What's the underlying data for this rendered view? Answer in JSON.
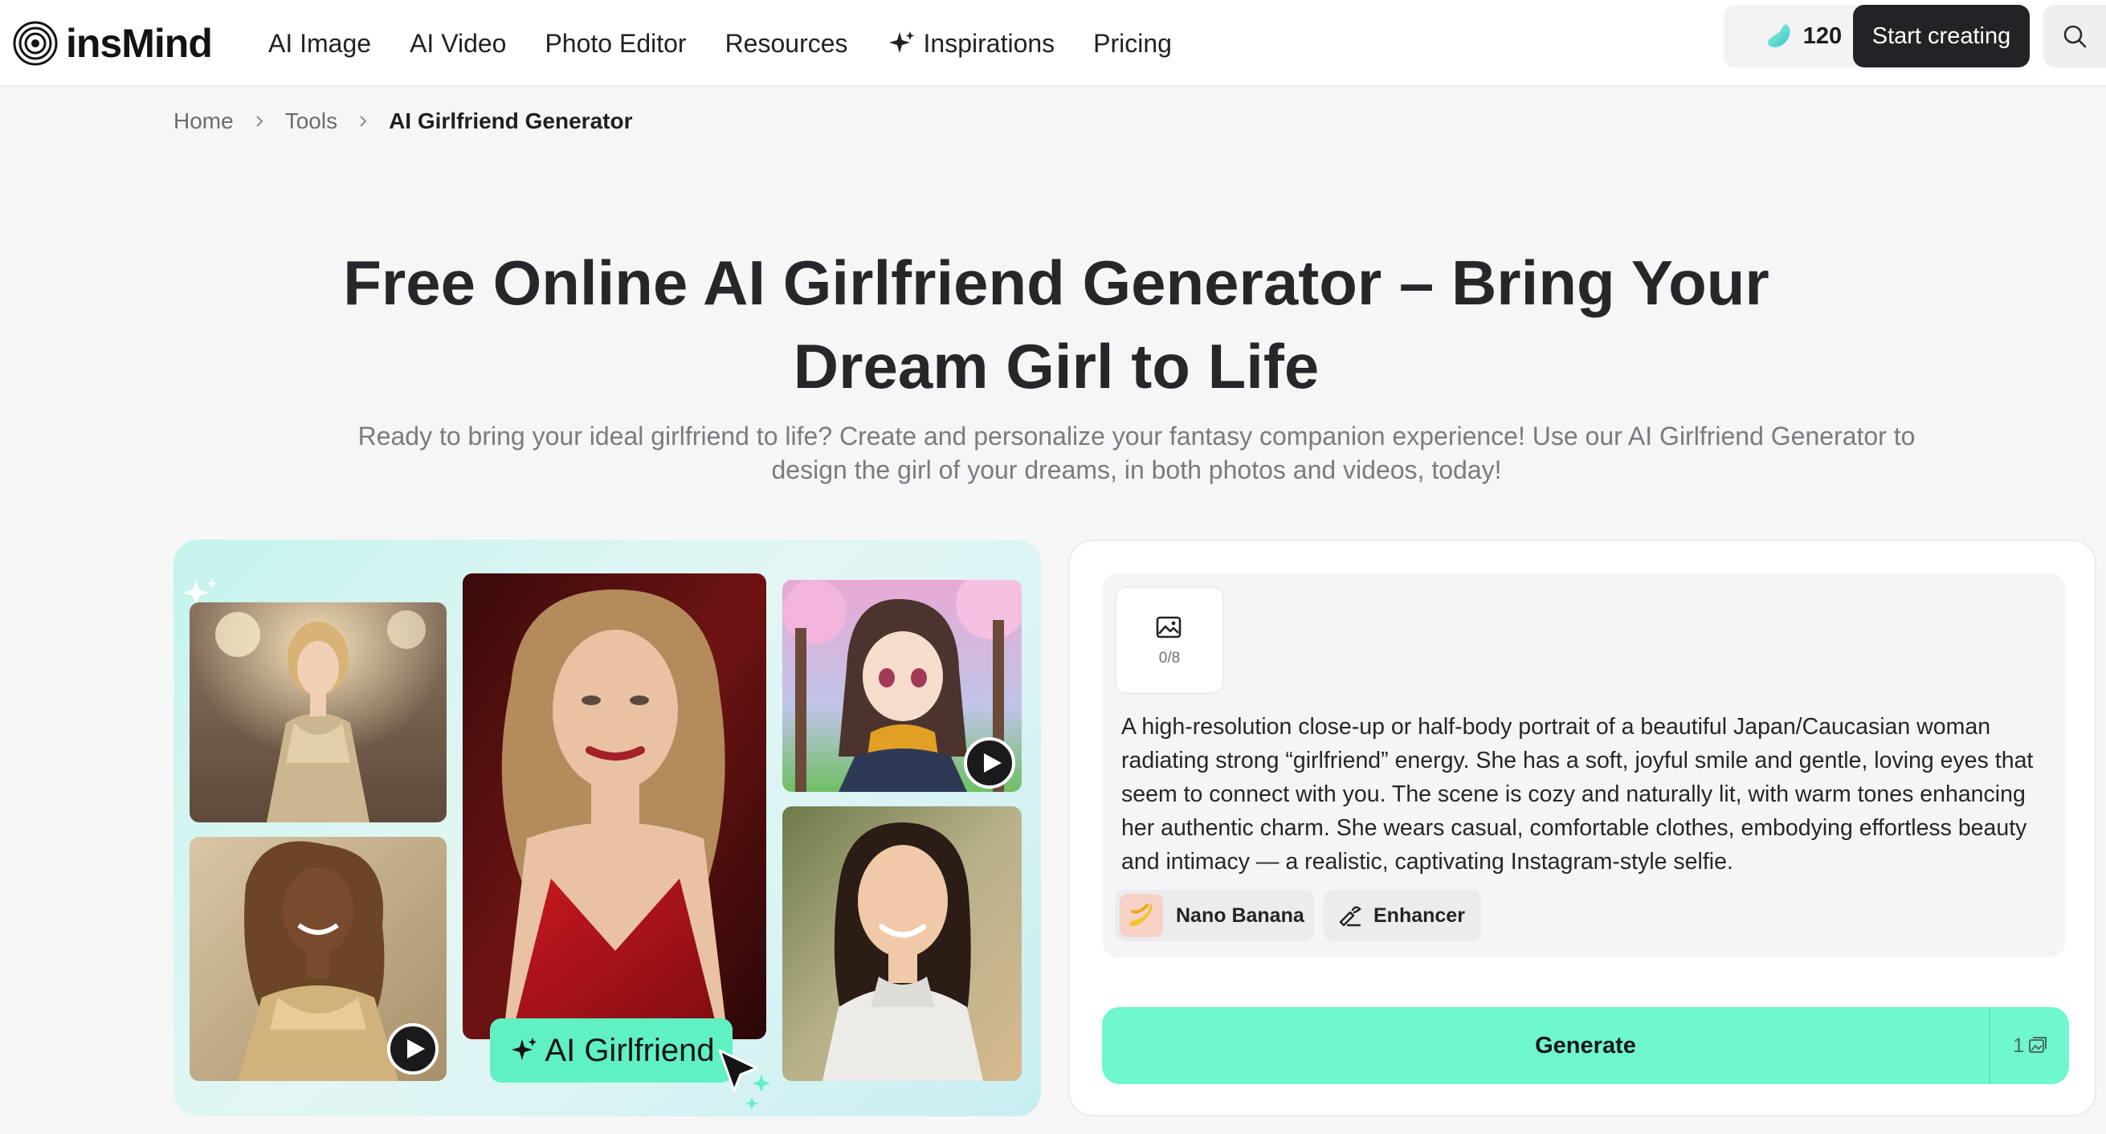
{
  "header": {
    "logo_text": "insMind",
    "nav": [
      {
        "label": "AI Image"
      },
      {
        "label": "AI Video"
      },
      {
        "label": "Photo Editor"
      },
      {
        "label": "Resources"
      },
      {
        "label": "Inspirations",
        "icon": "sparkle-icon"
      },
      {
        "label": "Pricing"
      }
    ],
    "credits": "120",
    "start_label": "Start creating"
  },
  "breadcrumb": [
    "Home",
    "Tools",
    "AI Girlfriend Generator"
  ],
  "hero": {
    "title": "Free Online AI Girlfriend Generator – Bring Your Dream Girl to Life",
    "subtitle": "Ready to bring your ideal girlfriend to life? Create and personalize your fantasy companion experience! Use our AI Girlfriend Generator to design the girl of your dreams, in both photos and videos, today!"
  },
  "showcase": {
    "tag_label": "AI Girlfriend"
  },
  "generator": {
    "upload_count": "0/8",
    "prompt": "A high-resolution close-up or half-body portrait of a beautiful Japan/Caucasian woman radiating strong “girlfriend” energy. She has a soft, joyful smile and gentle, loving eyes that seem to connect with you. The scene is cozy and naturally lit, with warm tones enhancing her authentic charm. She wears casual, comfortable clothes, embodying effortless beauty and intimacy — a realistic, captivating Instagram-style selfie.",
    "model_label": "Nano Banana",
    "enhancer_label": "Enhancer",
    "generate_label": "Generate",
    "output_count": "1"
  },
  "colors": {
    "accent": "#6ff7cf",
    "tag": "#5ff0c4",
    "dark_button": "#232327"
  }
}
